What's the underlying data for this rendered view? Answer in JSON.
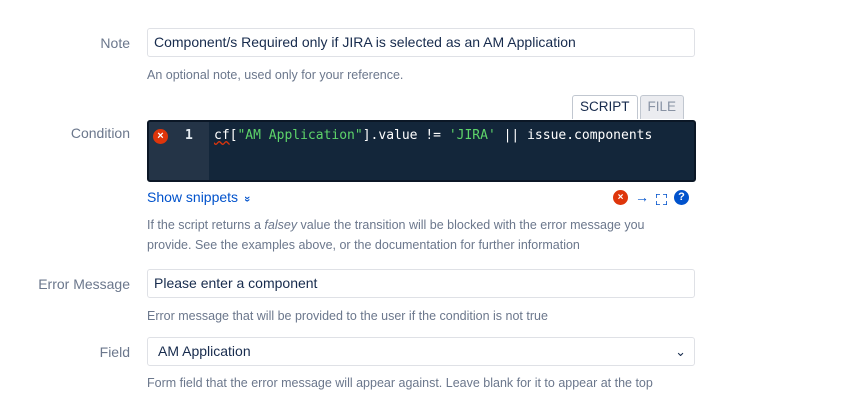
{
  "note": {
    "label": "Note",
    "value": "Component/s Required only if JIRA is selected as an AM Application",
    "help": "An optional note, used only for your reference."
  },
  "condition": {
    "label": "Condition",
    "tabs": {
      "script": "SCRIPT",
      "file": "FILE"
    },
    "line_number": "1",
    "code": {
      "p1": "cf",
      "p2": "[",
      "p3": "\"AM Application\"",
      "p4": "].value != ",
      "p5": "'JIRA'",
      "p6": " || issue.components"
    },
    "show_snippets": "Show snippets",
    "help_1": "If the script returns a ",
    "help_em": "falsey",
    "help_2": " value the transition will be blocked with the error message you provide. See the examples above, or the documentation for further information"
  },
  "error_message": {
    "label": "Error Message",
    "value": "Please enter a component",
    "help": "Error message that will be provided to the user if the condition is not true"
  },
  "field": {
    "label": "Field",
    "selected": "AM Application",
    "help": "Form field that the error message will appear against. Leave blank for it to appear at the top"
  },
  "colors": {
    "editor_bg": "#13263a",
    "string": "#5ed46a",
    "error": "#de350b",
    "link": "#0052cc"
  }
}
